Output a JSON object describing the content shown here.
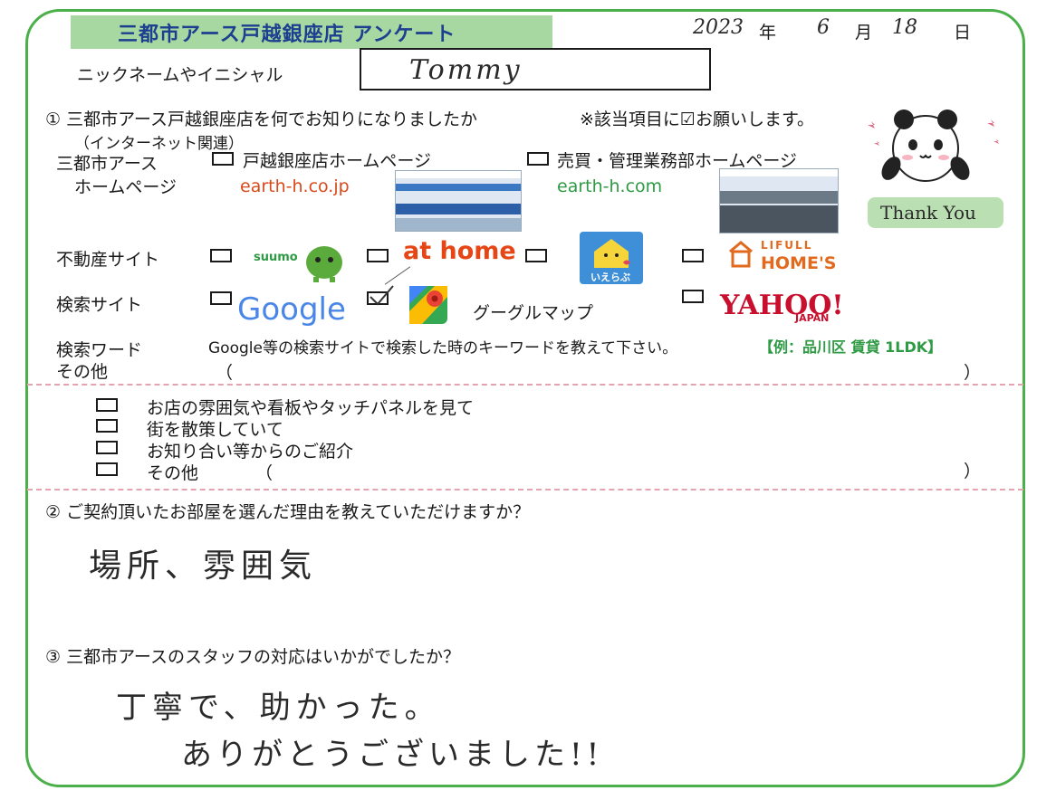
{
  "header": {
    "title": "三都市アース戸越銀座店 アンケート",
    "date_year": "2023",
    "year_label": "年",
    "date_month": "6",
    "month_label": "月",
    "date_day": "18",
    "day_label": "日"
  },
  "nickname": {
    "label": "ニックネームやイニシャル",
    "value": "Tommy"
  },
  "q1": {
    "question": "① 三都市アース戸越銀座店を何でお知りになりましたか",
    "note": "※該当項目に☑お願いします。",
    "internet_label": "（インターネット関連）",
    "homepage_label_1": "三都市アース",
    "homepage_label_2": "ホームページ",
    "option_togoshi": "戸越銀座店ホームページ",
    "url_togoshi": "earth-h.co.jp",
    "option_baibai": "売買・管理業務部ホームページ",
    "url_baibai": "earth-h.com",
    "realestate_label": "不動産サイト",
    "suumo": "suumo",
    "athome": "at home",
    "ieurabu": "いえらぶ",
    "lifull": "LIFULL",
    "homes": "HOME'S",
    "search_label": "検索サイト",
    "google": "Google",
    "googlemap": "グーグルマップ",
    "yahoo": "YAHOO!",
    "yahoo_japan": "JAPAN",
    "keyword_label": "検索ワード",
    "other_label": "その他",
    "keyword_prompt": "Google等の検索サイトで検索した時のキーワードを教えて下さい。",
    "keyword_example": "【例：品川区 賃貸 1LDK】",
    "open_paren": "（",
    "close_paren": "）",
    "offline_1": "お店の雰囲気や看板やタッチパネルを見て",
    "offline_2": "街を散策していて",
    "offline_3": "お知り合い等からのご紹介",
    "offline_4": "その他",
    "thank_you": "Thank You"
  },
  "q2": {
    "question": "② ご契約頂いたお部屋を選んだ理由を教えていただけますか？",
    "answer": "場所、雰囲気"
  },
  "q3": {
    "question": "③ 三都市アースのスタッフの対応はいかがでしたか？",
    "answer_line1": "丁寧で、助かった。",
    "answer_line2": "ありがとうございました!!"
  },
  "colors": {
    "frame": "#4bb04a",
    "title_band": "#a8d8a2",
    "title_text": "#1d3f8f",
    "url_orange": "#d84a1b",
    "url_green": "#2e9a44",
    "divider": "#e3a3b1",
    "example_green": "#2e9a44"
  }
}
